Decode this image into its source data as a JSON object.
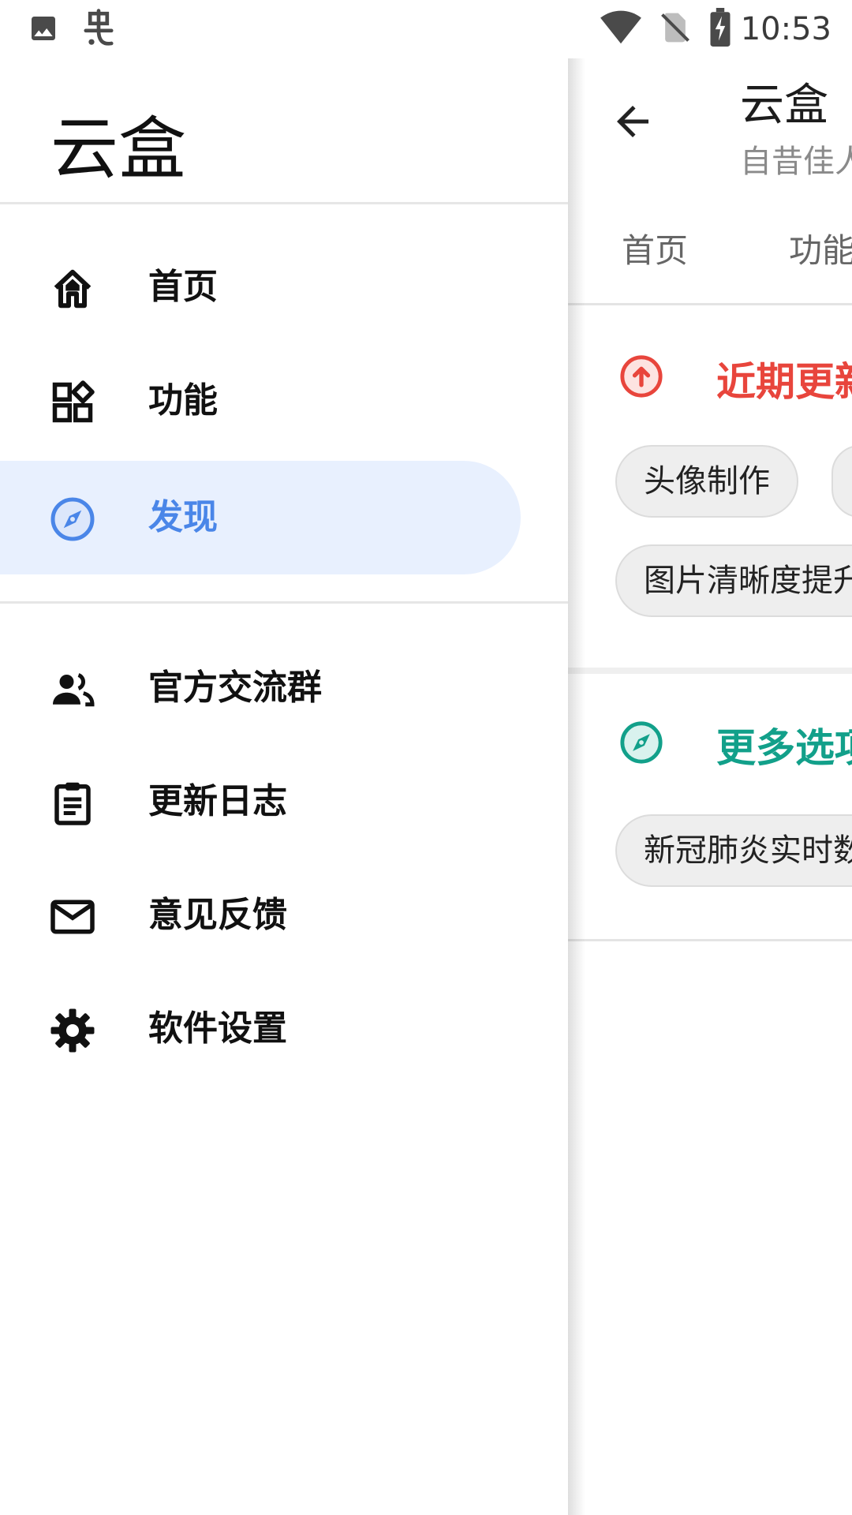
{
  "status_bar": {
    "time": "10:53",
    "left_icons": [
      "image-icon",
      "bug-icon"
    ],
    "right_icons": [
      "wifi-icon",
      "no-sim-icon",
      "battery-charging-icon"
    ]
  },
  "drawer": {
    "title": "云盒",
    "primary_items": [
      {
        "label": "首页",
        "icon": "home-icon",
        "active": false
      },
      {
        "label": "功能",
        "icon": "apps-icon",
        "active": false
      },
      {
        "label": "发现",
        "icon": "compass-icon",
        "active": true
      }
    ],
    "secondary_items": [
      {
        "label": "官方交流群",
        "icon": "group-icon"
      },
      {
        "label": "更新日志",
        "icon": "clipboard-icon"
      },
      {
        "label": "意见反馈",
        "icon": "mail-icon"
      },
      {
        "label": "软件设置",
        "icon": "gear-icon"
      }
    ],
    "active_color": "#4a86e8",
    "active_bg": "#e8f0fe"
  },
  "main": {
    "title": "云盒",
    "subtitle": "自昔佳人",
    "tabs": [
      "首页",
      "功能"
    ],
    "sections": [
      {
        "title": "近期更新",
        "icon": "arrow-up-circle-icon",
        "color": "#e8453c",
        "chips": [
          [
            "头像制作",
            ""
          ],
          [
            "图片清晰度提升"
          ]
        ]
      },
      {
        "title": "更多选项",
        "icon": "compass-icon",
        "color": "#12a08a",
        "chips": [
          [
            "新冠肺炎实时数据"
          ]
        ]
      }
    ]
  }
}
